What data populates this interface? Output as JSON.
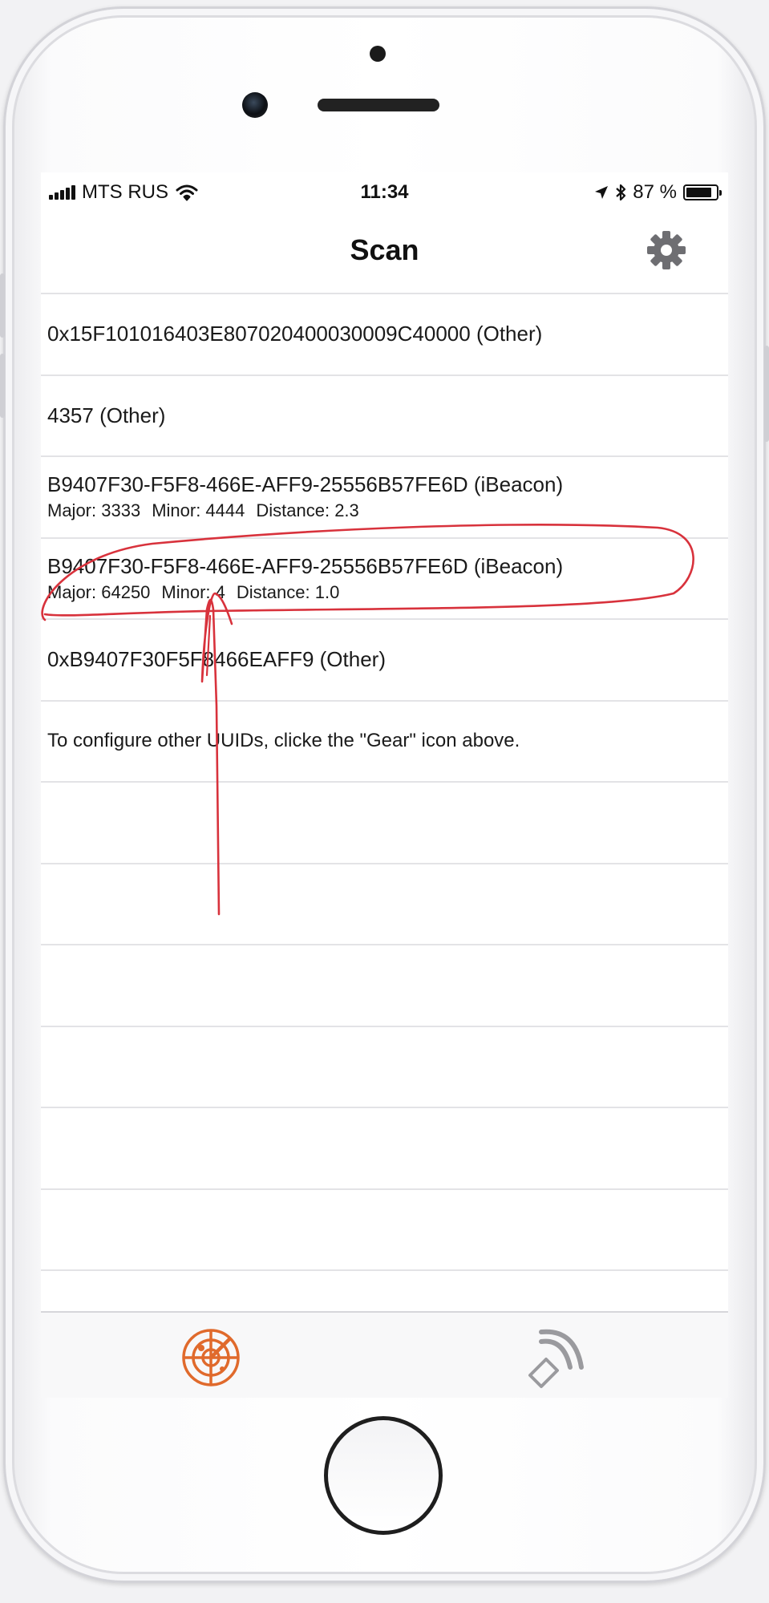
{
  "status_bar": {
    "carrier": "MTS RUS",
    "time": "11:34",
    "battery_percent": "87 %",
    "battery_level": 0.87
  },
  "nav": {
    "title": "Scan",
    "settings_icon": "gear-icon"
  },
  "beacons": [
    {
      "name": "0x15F101016403E807020400030009C40000 (Other)"
    },
    {
      "name": "4357 (Other)"
    },
    {
      "name": "B9407F30-F5F8-466E-AFF9-25556B57FE6D (iBeacon)",
      "major": "Major: 3333",
      "minor": "Minor: 4444",
      "distance": "Distance: 2.3"
    },
    {
      "name": "B9407F30-F5F8-466E-AFF9-25556B57FE6D (iBeacon)",
      "major": "Major: 64250",
      "minor": "Minor: 4",
      "distance": "Distance: 1.0"
    },
    {
      "name": "0xB9407F30F5F8466EAFF9 (Other)"
    }
  ],
  "hint": "To configure other UUIDs, clicke the \"Gear\" icon above.",
  "tabs": [
    {
      "icon": "radar-icon",
      "active": true
    },
    {
      "icon": "broadcast-icon",
      "active": false
    }
  ],
  "colors": {
    "accent": "#e06a2c",
    "inactive_tab": "#9a9a9e",
    "annotation": "#d8323c"
  }
}
